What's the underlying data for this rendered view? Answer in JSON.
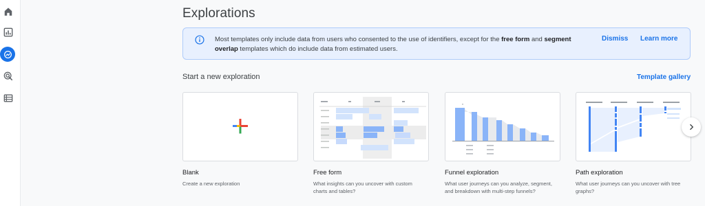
{
  "nav": {
    "items": [
      {
        "icon": "home-icon",
        "active": false
      },
      {
        "icon": "reports-icon",
        "active": false
      },
      {
        "icon": "explore-icon",
        "active": true
      },
      {
        "icon": "advertising-icon",
        "active": false
      },
      {
        "icon": "configure-icon",
        "active": false
      }
    ]
  },
  "page": {
    "title": "Explorations"
  },
  "banner": {
    "text_part1": "Most templates only include data from users who consented to the use of identifiers, except for the ",
    "bold1": "free form",
    "text_part2": " and ",
    "bold2": "segment overlap",
    "text_part3": " templates which do include data from estimated users.",
    "dismiss_label": "Dismiss",
    "learn_more_label": "Learn more"
  },
  "section": {
    "label": "Start a new exploration",
    "gallery_label": "Template gallery"
  },
  "templates": [
    {
      "title": "Blank",
      "description": "Create a new exploration"
    },
    {
      "title": "Free form",
      "description": "What insights can you uncover with custom charts and tables?"
    },
    {
      "title": "Funnel exploration",
      "description": "What user journeys can you analyze, segment, and breakdown with multi-step funnels?"
    },
    {
      "title": "Path exploration",
      "description": "What user journeys can you uncover with tree graphs?"
    }
  ],
  "colors": {
    "accent": "#1a73e8",
    "bar": "#8ab4f8",
    "banner_bg": "#e8f0fe",
    "google_red": "#ea4335",
    "google_yellow": "#fbbc04",
    "google_green": "#34a853",
    "google_blue": "#4285f4"
  }
}
